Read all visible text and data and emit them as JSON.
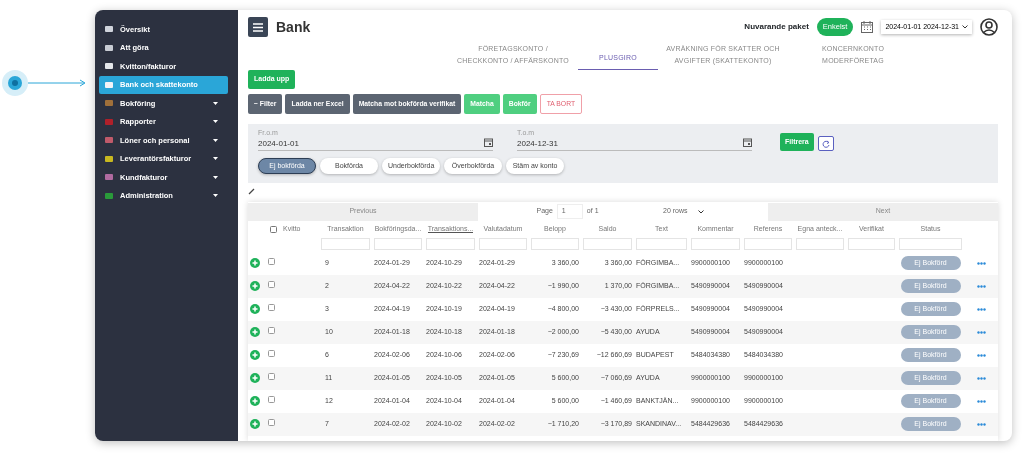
{
  "sidebar": {
    "items": [
      {
        "label": "Översikt",
        "color": "#d0d4dc",
        "selected": false,
        "expandable": false
      },
      {
        "label": "Att göra",
        "color": "#c8ccd4",
        "selected": false,
        "expandable": false
      },
      {
        "label": "Kvitton/fakturor",
        "color": "#e4e6ea",
        "selected": false,
        "expandable": false
      },
      {
        "label": "Bank och skattekonto",
        "color": "#f2f4f8",
        "selected": true,
        "expandable": false
      },
      {
        "label": "Bokföring",
        "color": "#a0703a",
        "selected": false,
        "expandable": true
      },
      {
        "label": "Rapporter",
        "color": "#b0202a",
        "selected": false,
        "expandable": true
      },
      {
        "label": "Löner och personal",
        "color": "#c05a6a",
        "selected": false,
        "expandable": true
      },
      {
        "label": "Leverantörsfakturor",
        "color": "#c8b820",
        "selected": false,
        "expandable": true
      },
      {
        "label": "Kundfakturor",
        "color": "#b06aa0",
        "selected": false,
        "expandable": true
      },
      {
        "label": "Administration",
        "color": "#2a9a3a",
        "selected": false,
        "expandable": true
      }
    ]
  },
  "header": {
    "title": "Bank",
    "package_label": "Nuvarande paket",
    "package": "Enkelst",
    "period": "2024-01-01 2024-12-31"
  },
  "tabs": [
    {
      "label": "FÖRETAGSKONTO / CHECKKONTO / AFFÄRSKONTO",
      "selected": false
    },
    {
      "label": "PLUSGIRO",
      "selected": true
    },
    {
      "label": "AVRÄKNING FÖR SKATTER OCH AVGIFTER (SKATTEKONTO)",
      "selected": false
    },
    {
      "label": "KONCERNKONTO MODERFÖRETAG",
      "selected": false
    }
  ],
  "upload_button": "Ladda upp",
  "toolbar": [
    {
      "label": "− Filter",
      "kind": "dark"
    },
    {
      "label": "Ladda ner Excel",
      "kind": "dark"
    },
    {
      "label": "Matcha mot bokförda verifikat",
      "kind": "dark"
    },
    {
      "label": "Matcha",
      "kind": "success"
    },
    {
      "label": "Bokför",
      "kind": "success"
    },
    {
      "label": "TA BORT",
      "kind": "danger"
    }
  ],
  "filter": {
    "from_label": "Fr.o.m",
    "from": "2024-01-01",
    "to_label": "T.o.m",
    "to": "2024-12-31",
    "apply": "Filtrera",
    "segments": [
      {
        "label": "Ej bokförda",
        "selected": true
      },
      {
        "label": "Bokförda",
        "selected": false
      },
      {
        "label": "Underbokförda",
        "selected": false
      },
      {
        "label": "Överbokförda",
        "selected": false
      },
      {
        "label": "Stäm av konto",
        "selected": false
      }
    ]
  },
  "pagination": {
    "previous": "Previous",
    "page_label": "Page",
    "page": "1",
    "of": "of 1",
    "rows": "20 rows",
    "next": "Next"
  },
  "table": {
    "select_all_checked": false,
    "columns": [
      {
        "label": "Kvitto",
        "sorted": false,
        "filterable": false
      },
      {
        "label": "Transaktion",
        "sorted": false,
        "filterable": true
      },
      {
        "label": "Bokföringsda...",
        "sorted": false,
        "filterable": true
      },
      {
        "label": "Transaktions...",
        "sorted": true,
        "filterable": true
      },
      {
        "label": "Valutadatum",
        "sorted": false,
        "filterable": true
      },
      {
        "label": "Belopp",
        "sorted": false,
        "filterable": true
      },
      {
        "label": "Saldo",
        "sorted": false,
        "filterable": true
      },
      {
        "label": "Text",
        "sorted": false,
        "filterable": true
      },
      {
        "label": "Kommentar",
        "sorted": false,
        "filterable": true
      },
      {
        "label": "Referens",
        "sorted": false,
        "filterable": true
      },
      {
        "label": "Egna anteck...",
        "sorted": false,
        "filterable": true
      },
      {
        "label": "Verifikat",
        "sorted": false,
        "filterable": true
      },
      {
        "label": "Status",
        "sorted": false,
        "filterable": true
      }
    ],
    "rows": [
      {
        "checked": false,
        "transaction": "9",
        "booking_date": "2024-01-29",
        "transaction_date": "2024-10-29",
        "value_date": "2024-01-29",
        "amount": "3 360,00",
        "balance": "3 360,00",
        "text": "FÖRGIMBA...",
        "comment": "9900000100",
        "reference": "9900000100",
        "status": "Ej Bokförd"
      },
      {
        "checked": false,
        "transaction": "2",
        "booking_date": "2024-04-22",
        "transaction_date": "2024-10-22",
        "value_date": "2024-04-22",
        "amount": "−1 990,00",
        "balance": "1 370,00",
        "text": "FÖRGIMBA...",
        "comment": "5490990004",
        "reference": "5490990004",
        "status": "Ej Bokförd"
      },
      {
        "checked": false,
        "transaction": "3",
        "booking_date": "2024-04-19",
        "transaction_date": "2024-10-19",
        "value_date": "2024-04-19",
        "amount": "−4 800,00",
        "balance": "−3 430,00",
        "text": "FÖRPRELS...",
        "comment": "5490990004",
        "reference": "5490990004",
        "status": "Ej Bokförd"
      },
      {
        "checked": false,
        "transaction": "10",
        "booking_date": "2024-01-18",
        "transaction_date": "2024-10-18",
        "value_date": "2024-01-18",
        "amount": "−2 000,00",
        "balance": "−5 430,00",
        "text": "AYUDA",
        "comment": "5490990004",
        "reference": "5490990004",
        "status": "Ej Bokförd"
      },
      {
        "checked": false,
        "transaction": "6",
        "booking_date": "2024-02-06",
        "transaction_date": "2024-10-06",
        "value_date": "2024-02-06",
        "amount": "−7 230,69",
        "balance": "−12 660,69",
        "text": "BUDAPEST",
        "comment": "5484034380",
        "reference": "5484034380",
        "status": "Ej Bokförd"
      },
      {
        "checked": false,
        "transaction": "11",
        "booking_date": "2024-01-05",
        "transaction_date": "2024-10-05",
        "value_date": "2024-01-05",
        "amount": "5 600,00",
        "balance": "−7 060,69",
        "text": "AYUDA",
        "comment": "9900000100",
        "reference": "9900000100",
        "status": "Ej Bokförd"
      },
      {
        "checked": false,
        "transaction": "12",
        "booking_date": "2024-01-04",
        "transaction_date": "2024-10-04",
        "value_date": "2024-01-04",
        "amount": "5 600,00",
        "balance": "−1 460,69",
        "text": "BANKTJÄN...",
        "comment": "9900000100",
        "reference": "9900000100",
        "status": "Ej Bokförd"
      },
      {
        "checked": false,
        "transaction": "7",
        "booking_date": "2024-02-02",
        "transaction_date": "2024-10-02",
        "value_date": "2024-02-02",
        "amount": "−1 710,20",
        "balance": "−3 170,89",
        "text": "SKANDINAV...",
        "comment": "5484429636",
        "reference": "5484429636",
        "status": "Ej Bokförd"
      }
    ]
  }
}
